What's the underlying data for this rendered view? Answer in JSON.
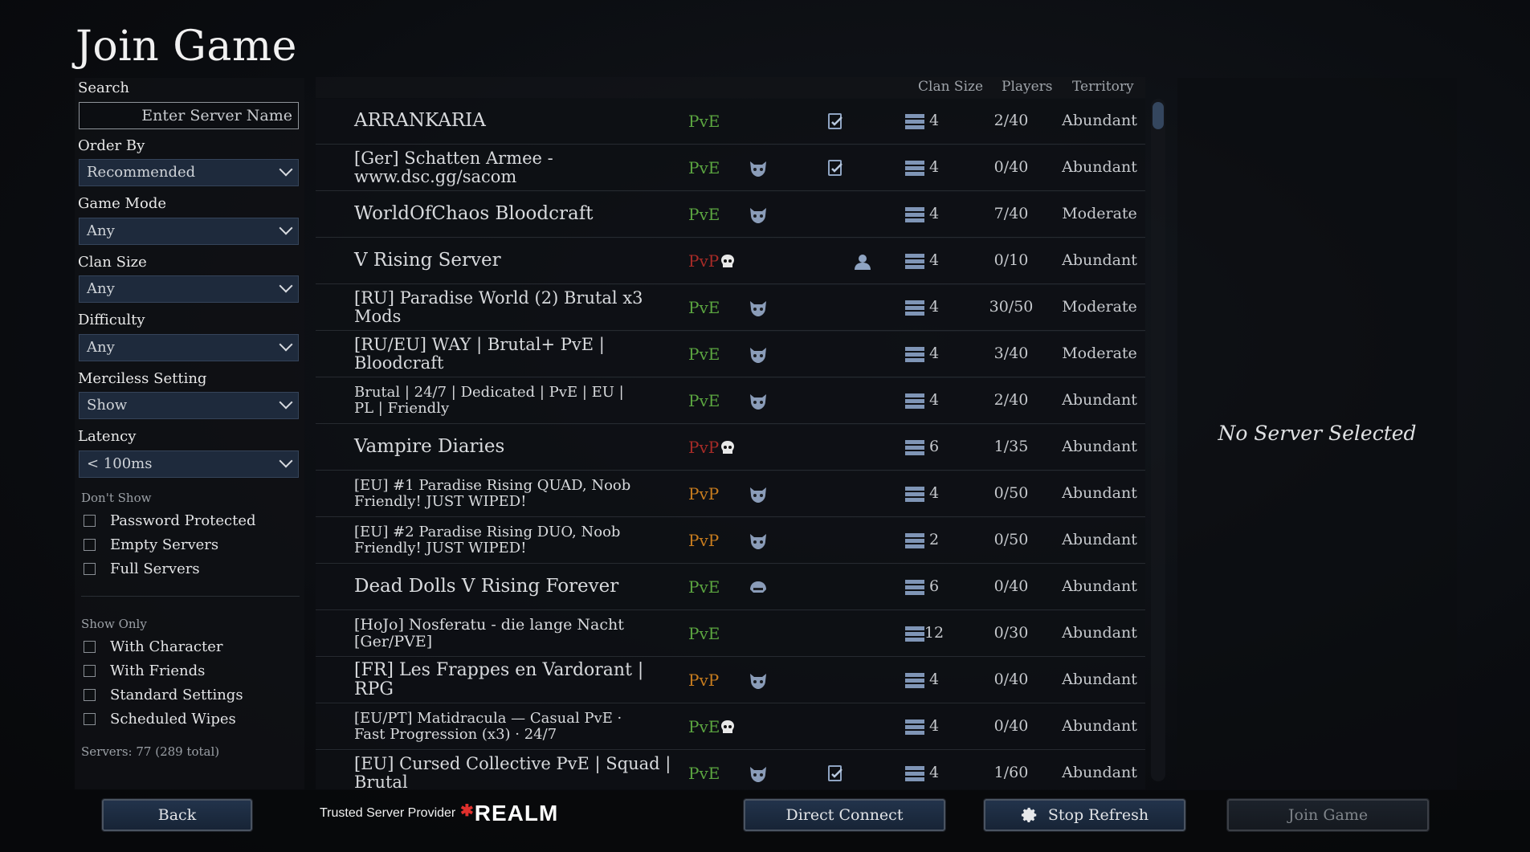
{
  "title": "Join Game",
  "filters": {
    "search_label": "Search",
    "search_placeholder": "Enter Server Name",
    "order_by_label": "Order By",
    "order_by_value": "Recommended",
    "game_mode_label": "Game Mode",
    "game_mode_value": "Any",
    "clan_size_label": "Clan Size",
    "clan_size_value": "Any",
    "difficulty_label": "Difficulty",
    "difficulty_value": "Any",
    "merciless_label": "Merciless Setting",
    "merciless_value": "Show",
    "latency_label": "Latency",
    "latency_value": "< 100ms",
    "dont_show_label": "Don't Show",
    "dont_show": [
      "Password Protected",
      "Empty Servers",
      "Full Servers"
    ],
    "show_only_label": "Show Only",
    "show_only": [
      "With Character",
      "With Friends",
      "Standard Settings",
      "Scheduled Wipes"
    ],
    "servers_count": "Servers: 77 (289 total)"
  },
  "list_header": {
    "clan_size": "Clan Size",
    "players": "Players",
    "territory": "Territory"
  },
  "servers": [
    {
      "name": "ARRANKARIA",
      "mode": "PvE",
      "clan": "4",
      "players": "2/40",
      "territory": "Abundant"
    },
    {
      "name": "[Ger] Schatten Armee - www.dsc.gg/sacom",
      "mode": "PvE",
      "clan": "4",
      "players": "0/40",
      "territory": "Abundant"
    },
    {
      "name": "WorldOfChaos Bloodcraft",
      "mode": "PvE",
      "clan": "4",
      "players": "7/40",
      "territory": "Moderate"
    },
    {
      "name": "V Rising Server",
      "mode": "PvP",
      "clan": "4",
      "players": "0/10",
      "territory": "Abundant"
    },
    {
      "name": "[RU] Paradise World (2) Brutal x3 Mods",
      "mode": "PvE",
      "clan": "4",
      "players": "30/50",
      "territory": "Moderate"
    },
    {
      "name": "[RU/EU] WAY | Brutal+ PvE | Bloodcraft",
      "mode": "PvE",
      "clan": "4",
      "players": "3/40",
      "territory": "Moderate"
    },
    {
      "name": "Brutal | 24/7 | Dedicated | PvE | EU | PL | Friendly",
      "mode": "PvE",
      "clan": "4",
      "players": "2/40",
      "territory": "Abundant"
    },
    {
      "name": "Vampire Diaries",
      "mode": "PvP",
      "clan": "6",
      "players": "1/35",
      "territory": "Abundant"
    },
    {
      "name": "[EU] #1 Paradise Rising QUAD, Noob Friendly! JUST WIPED!",
      "mode": "PvP",
      "clan": "4",
      "players": "0/50",
      "territory": "Abundant"
    },
    {
      "name": "[EU] #2 Paradise Rising DUO, Noob Friendly! JUST WIPED!",
      "mode": "PvP",
      "clan": "2",
      "players": "0/50",
      "territory": "Abundant"
    },
    {
      "name": "Dead Dolls V Rising Forever",
      "mode": "PvE",
      "clan": "6",
      "players": "0/40",
      "territory": "Abundant"
    },
    {
      "name": "[HoJo] Nosferatu - die lange Nacht [Ger/PVE]",
      "mode": "PvE",
      "clan": "12",
      "players": "0/30",
      "territory": "Abundant"
    },
    {
      "name": "[FR] Les Frappes en Vardorant | RPG",
      "mode": "PvP",
      "clan": "4",
      "players": "0/40",
      "territory": "Abundant"
    },
    {
      "name": "[EU/PT] Matidracula — Casual PvE · Fast Progression (x3) · 24/7",
      "mode": "PvE",
      "clan": "4",
      "players": "0/40",
      "territory": "Abundant"
    },
    {
      "name": "[EU] Cursed Collective PvE | Squad | Brutal",
      "mode": "PvE",
      "clan": "4",
      "players": "1/60",
      "territory": "Abundant"
    }
  ],
  "detail": {
    "no_selection": "No Server Selected"
  },
  "footer": {
    "back": "Back",
    "trusted": "Trusted Server Provider",
    "realm": "REALM",
    "direct_connect": "Direct Connect",
    "stop_refresh": "Stop Refresh",
    "join_game": "Join Game"
  },
  "colors": {
    "pve": "#5ba540",
    "pvp": "#a72b27",
    "pvp_alt": "#c77c1e",
    "accent": "#34465e"
  }
}
